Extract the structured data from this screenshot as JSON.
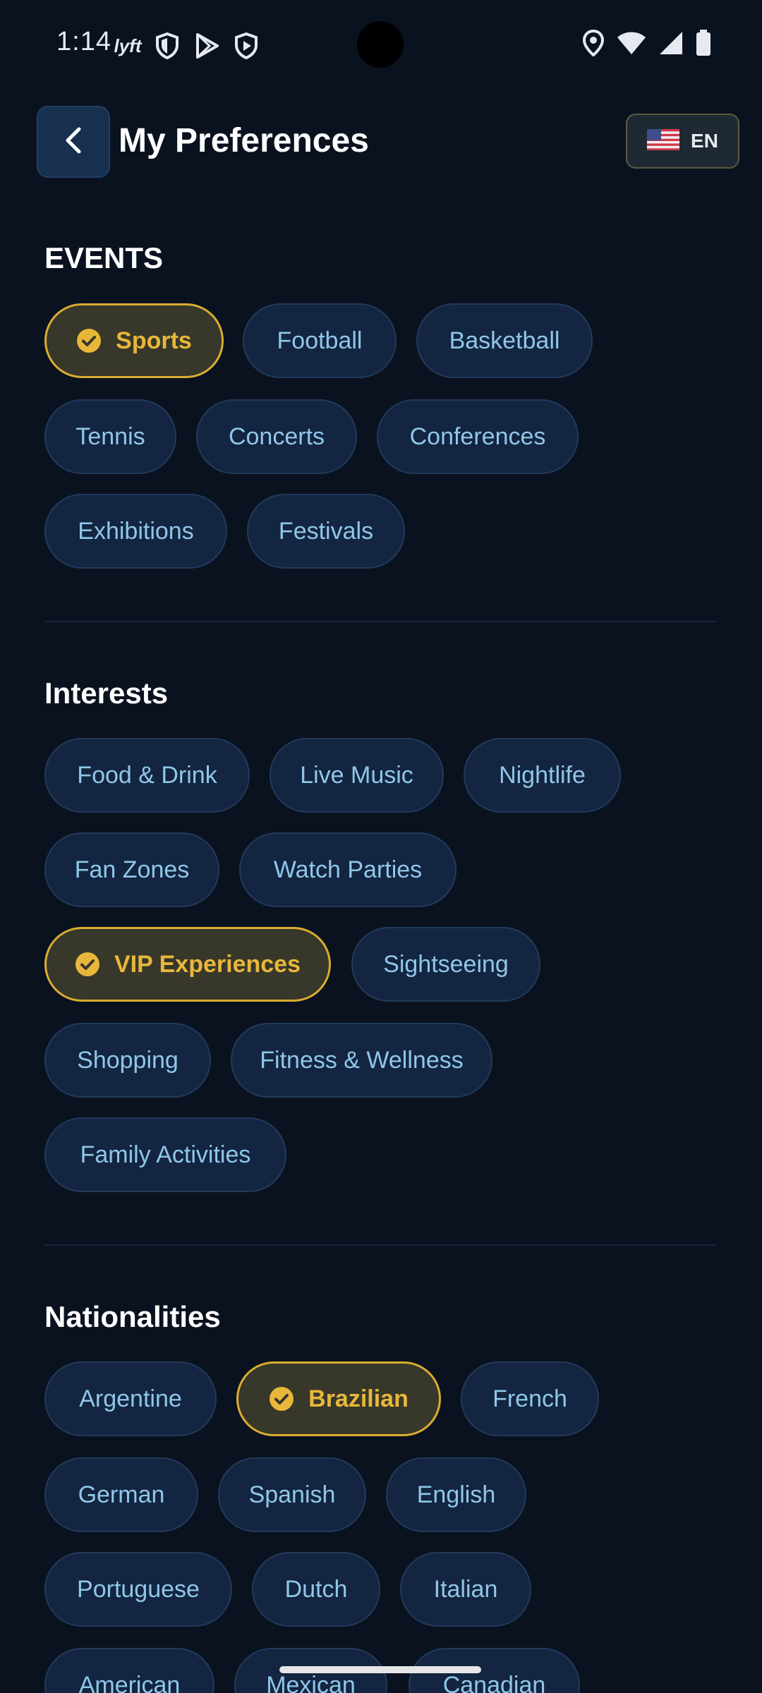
{
  "status_bar": {
    "time": "1:14",
    "left_icons": [
      "lyft-icon",
      "shield-icon",
      "play-store-icon",
      "shield-play-icon"
    ],
    "right_icons": [
      "location-icon",
      "wifi-icon",
      "signal-icon",
      "battery-icon"
    ],
    "lyft_label": "lyft"
  },
  "header": {
    "title": "My Preferences",
    "back_icon": "chevron-left-icon",
    "language": {
      "code": "EN",
      "flag": "us-flag-icon"
    }
  },
  "colors": {
    "background": "#0a1220",
    "chip_bg": "#132540",
    "chip_text": "#8fc7ea",
    "selected_border": "#d9ad2f",
    "selected_text": "#e8b73a"
  },
  "sections": {
    "events": {
      "title": "EVENTS",
      "chips": [
        {
          "label": "Sports",
          "selected": true
        },
        {
          "label": "Football",
          "selected": false
        },
        {
          "label": "Basketball",
          "selected": false
        },
        {
          "label": "Tennis",
          "selected": false
        },
        {
          "label": "Concerts",
          "selected": false
        },
        {
          "label": "Conferences",
          "selected": false
        },
        {
          "label": "Exhibitions",
          "selected": false
        },
        {
          "label": "Festivals",
          "selected": false
        }
      ]
    },
    "interests": {
      "title": "Interests",
      "chips": [
        {
          "label": "Food & Drink",
          "selected": false
        },
        {
          "label": "Live Music",
          "selected": false
        },
        {
          "label": "Nightlife",
          "selected": false
        },
        {
          "label": "Fan Zones",
          "selected": false
        },
        {
          "label": "Watch Parties",
          "selected": false
        },
        {
          "label": "VIP Experiences",
          "selected": true
        },
        {
          "label": "Sightseeing",
          "selected": false
        },
        {
          "label": "Shopping",
          "selected": false
        },
        {
          "label": "Fitness & Wellness",
          "selected": false
        },
        {
          "label": "Family Activities",
          "selected": false
        }
      ]
    },
    "nationalities": {
      "title": "Nationalities",
      "chips": [
        {
          "label": "Argentine",
          "selected": false
        },
        {
          "label": "Brazilian",
          "selected": true
        },
        {
          "label": "French",
          "selected": false
        },
        {
          "label": "German",
          "selected": false
        },
        {
          "label": "Spanish",
          "selected": false
        },
        {
          "label": "English",
          "selected": false
        },
        {
          "label": "Portuguese",
          "selected": false
        },
        {
          "label": "Dutch",
          "selected": false
        },
        {
          "label": "Italian",
          "selected": false
        },
        {
          "label": "American",
          "selected": false
        },
        {
          "label": "Mexican",
          "selected": false
        },
        {
          "label": "Canadian",
          "selected": false
        }
      ]
    }
  }
}
